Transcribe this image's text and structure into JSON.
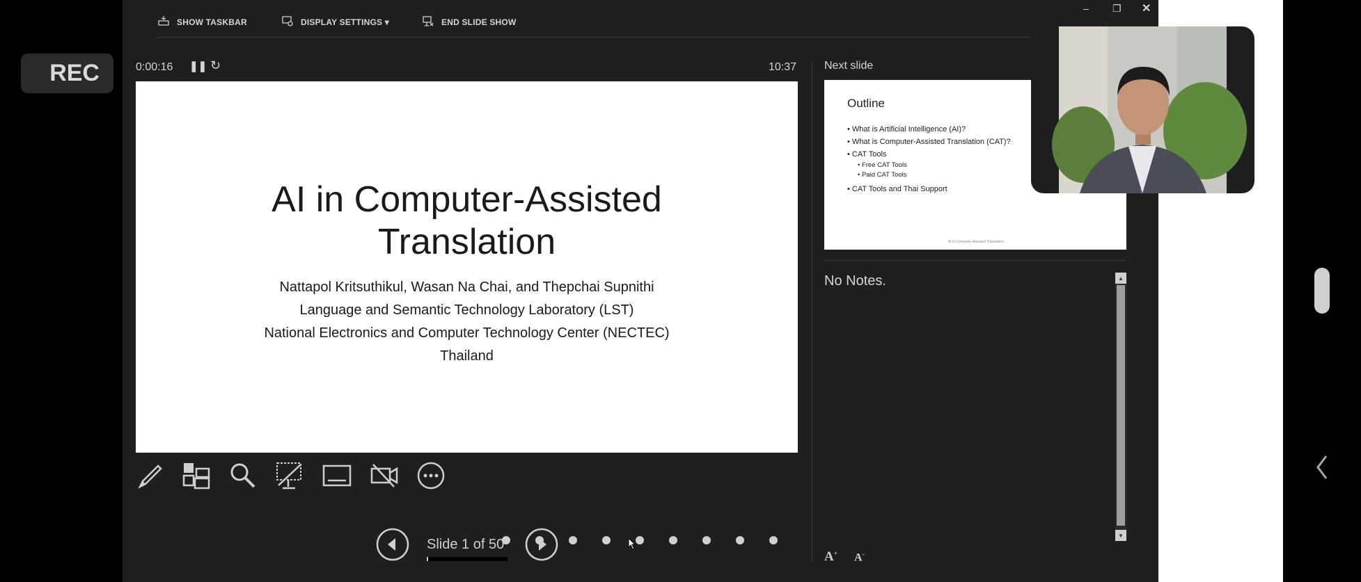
{
  "rec": {
    "label": "REC"
  },
  "toolbar": {
    "show_taskbar": "SHOW TASKBAR",
    "display_settings": "DISPLAY SETTINGS ▾",
    "end_slide_show": "END SLIDE SHOW"
  },
  "timer": {
    "elapsed": "0:00:16",
    "clock": "10:37"
  },
  "slide": {
    "title_line1": "AI in Computer-Assisted",
    "title_line2": "Translation",
    "lines": [
      "Nattapol Kritsuthikul, Wasan Na Chai, and Thepchai Supnithi",
      "Language and Semantic Technology Laboratory (LST)",
      "National Electronics and Computer Technology Center (NECTEC)",
      "Thailand"
    ]
  },
  "next_slide": {
    "heading": "Next slide",
    "title": "Outline",
    "bullets": [
      "• What is Artificial Intelligence (AI)?",
      "• What is Computer-Assisted Translation (CAT)?",
      "• CAT Tools",
      "• Free CAT Tools",
      "• Paid CAT Tools",
      "• CAT Tools and Thai Support"
    ],
    "footer_center": "AI in Computer-Assisted Translation"
  },
  "notes": {
    "text": "No Notes."
  },
  "navigation": {
    "slide_counter": "Slide 1 of 50",
    "progress": 0.02
  },
  "icons": [
    "pen-icon",
    "slides-grid-icon",
    "magnify-icon",
    "black-screen-icon",
    "subtitles-icon",
    "camera-off-icon",
    "more-icon",
    "previous-icon",
    "next-icon",
    "font-increase-icon",
    "font-decrease-icon",
    "minimize-icon",
    "restore-icon",
    "close-icon",
    "chevron-left-icon"
  ]
}
